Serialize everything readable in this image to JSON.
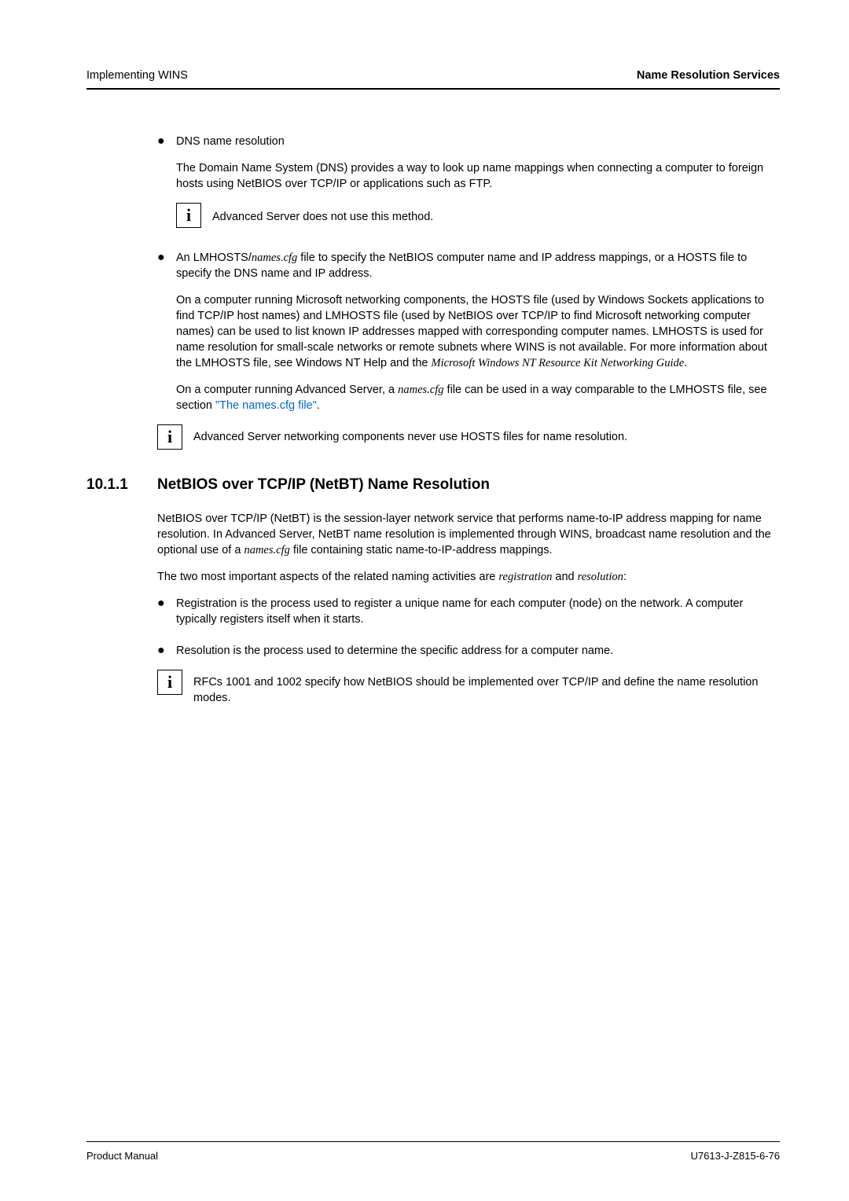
{
  "header": {
    "left": "Implementing WINS",
    "right": "Name Resolution Services"
  },
  "bullet1": {
    "title": "DNS name resolution",
    "para": "The Domain Name System (DNS) provides a way to look up name mappings when connecting a computer to foreign hosts using NetBIOS over TCP/IP or applications such as FTP.",
    "info": "Advanced Server does not use this method."
  },
  "bullet2": {
    "title_pre": "An LMHOSTS/",
    "title_italic": "names.cfg",
    "title_post": " file to specify the NetBIOS computer name and IP address mappings, or a HOSTS file to specify the DNS name and IP address.",
    "para1_pre": "On a computer running Microsoft networking components, the HOSTS file (used by Windows Sockets applications to find TCP/IP host names) and LMHOSTS file (used by NetBIOS over TCP/IP to find Microsoft networking computer names) can be used to list known IP addresses mapped with corresponding computer names. LMHOSTS is used for name resolution for small-scale networks or remote subnets where WINS is not available. For more information about the LMHOSTS file, see Windows NT Help and the ",
    "para1_italic": "Microsoft Windows NT Resource Kit Networking Guide",
    "para1_post": ".",
    "para2_pre": "On a computer running Advanced Server, a ",
    "para2_italic": "names.cfg",
    "para2_mid": " file can be used in a way comparable to the LMHOSTS file, see section ",
    "para2_link": "\"The names.cfg file\"",
    "para2_post": ".",
    "info": "Advanced Server networking components never use HOSTS files for name resolution."
  },
  "section": {
    "number": "10.1.1",
    "title": "NetBIOS over TCP/IP (NetBT) Name Resolution",
    "p1_pre": "NetBIOS over TCP/IP (NetBT) is the session-layer network service that performs name-to-IP address mapping for name resolution. In Advanced Server, NetBT name resolution is implemented through WINS, broadcast name resolution and the optional use of a ",
    "p1_italic": "names.cfg",
    "p1_post": " file containing static name-to-IP-address mappings.",
    "p2_pre": " The two most important aspects of the related naming activities are ",
    "p2_i1": "registration",
    "p2_mid": " and ",
    "p2_i2": "resolution",
    "p2_post": ":",
    "b1": "Registration is the process used to register a unique name for each computer (node) on the network. A computer typically registers itself when it starts.",
    "b2": "Resolution is the process used to determine the specific address for a computer name.",
    "info": "RFCs 1001 and 1002 specify how NetBIOS should be implemented over TCP/IP and define the name resolution modes."
  },
  "footer": {
    "left": "Product Manual",
    "right": "U7613-J-Z815-6-76"
  },
  "info_icon_glyph": "i"
}
